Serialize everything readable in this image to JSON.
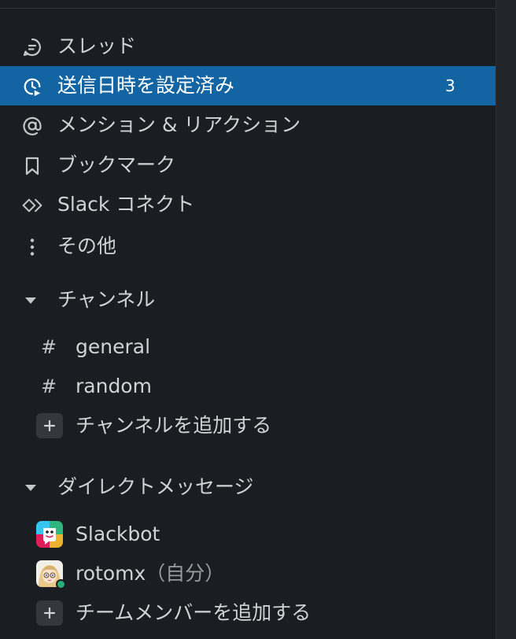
{
  "nav": {
    "threads": {
      "label": "スレッド",
      "icon": "threads-icon"
    },
    "scheduled": {
      "label": "送信日時を設定済み",
      "badge": "3",
      "icon": "scheduled-clock-icon"
    },
    "mentions": {
      "label": "メンション & リアクション",
      "icon": "at-sign-icon"
    },
    "bookmarks": {
      "label": "ブックマーク",
      "icon": "bookmark-icon"
    },
    "connect": {
      "label": "Slack コネクト",
      "icon": "slack-connect-icon"
    },
    "more": {
      "label": "その他",
      "icon": "more-vertical-icon"
    }
  },
  "channels": {
    "header": "チャンネル",
    "items": [
      {
        "prefix": "#",
        "label": "general"
      },
      {
        "prefix": "#",
        "label": "random"
      }
    ],
    "add_label": "チャンネルを追加する"
  },
  "direct_messages": {
    "header": "ダイレクトメッセージ",
    "items": [
      {
        "label": "Slackbot",
        "suffix": ""
      },
      {
        "label": "rotomx",
        "suffix": "（自分）"
      }
    ],
    "add_label": "チームメンバーを追加する"
  },
  "colors": {
    "sidebar_bg": "#1a1d21",
    "active_bg": "#1264a3",
    "text": "#d1d2d3",
    "presence": "#2bac76"
  }
}
